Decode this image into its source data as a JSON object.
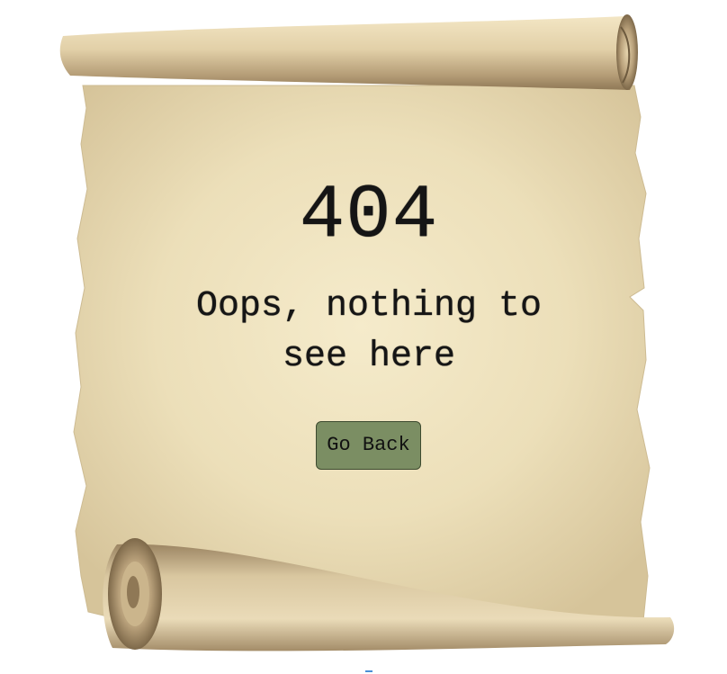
{
  "page": {
    "error_code": "404",
    "message": "Oops, nothing to see here",
    "back_button_label": "Go Back"
  },
  "colors": {
    "parchment": "#efe3c0",
    "parchment_edge": "#d8c9a0",
    "roll_light": "#e9dab6",
    "roll_dark": "#8a7454",
    "button_bg": "#7b8e63",
    "text": "#151515"
  }
}
